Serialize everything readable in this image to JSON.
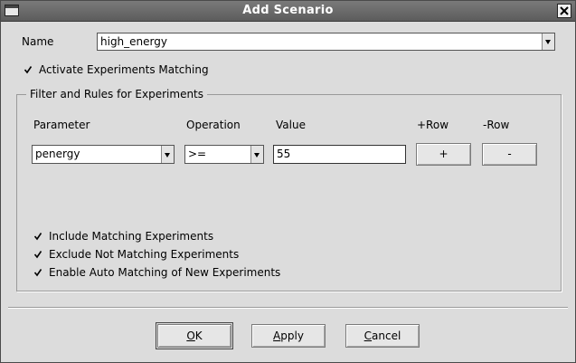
{
  "window": {
    "title": "Add Scenario"
  },
  "name_field": {
    "label": "Name",
    "value": "high_energy"
  },
  "activate": {
    "label": "Activate Experiments Matching",
    "checked": true
  },
  "group": {
    "title": "Filter and Rules for Experiments",
    "headers": {
      "parameter": "Parameter",
      "operation": "Operation",
      "value": "Value",
      "add_row": "+Row",
      "remove_row": "-Row"
    },
    "row": {
      "parameter": "penergy",
      "operation": ">=",
      "value": "55",
      "add_label": "+",
      "remove_label": "-"
    },
    "options": [
      {
        "label": "Include Matching Experiments",
        "checked": true
      },
      {
        "label": "Exclude Not Matching Experiments",
        "checked": true
      },
      {
        "label": "Enable Auto Matching of New Experiments",
        "checked": true
      }
    ]
  },
  "buttons": {
    "ok": {
      "mnemonic": "O",
      "rest": "K"
    },
    "apply": {
      "mnemonic": "A",
      "rest": "pply"
    },
    "cancel": {
      "mnemonic": "C",
      "rest": "ancel"
    }
  }
}
